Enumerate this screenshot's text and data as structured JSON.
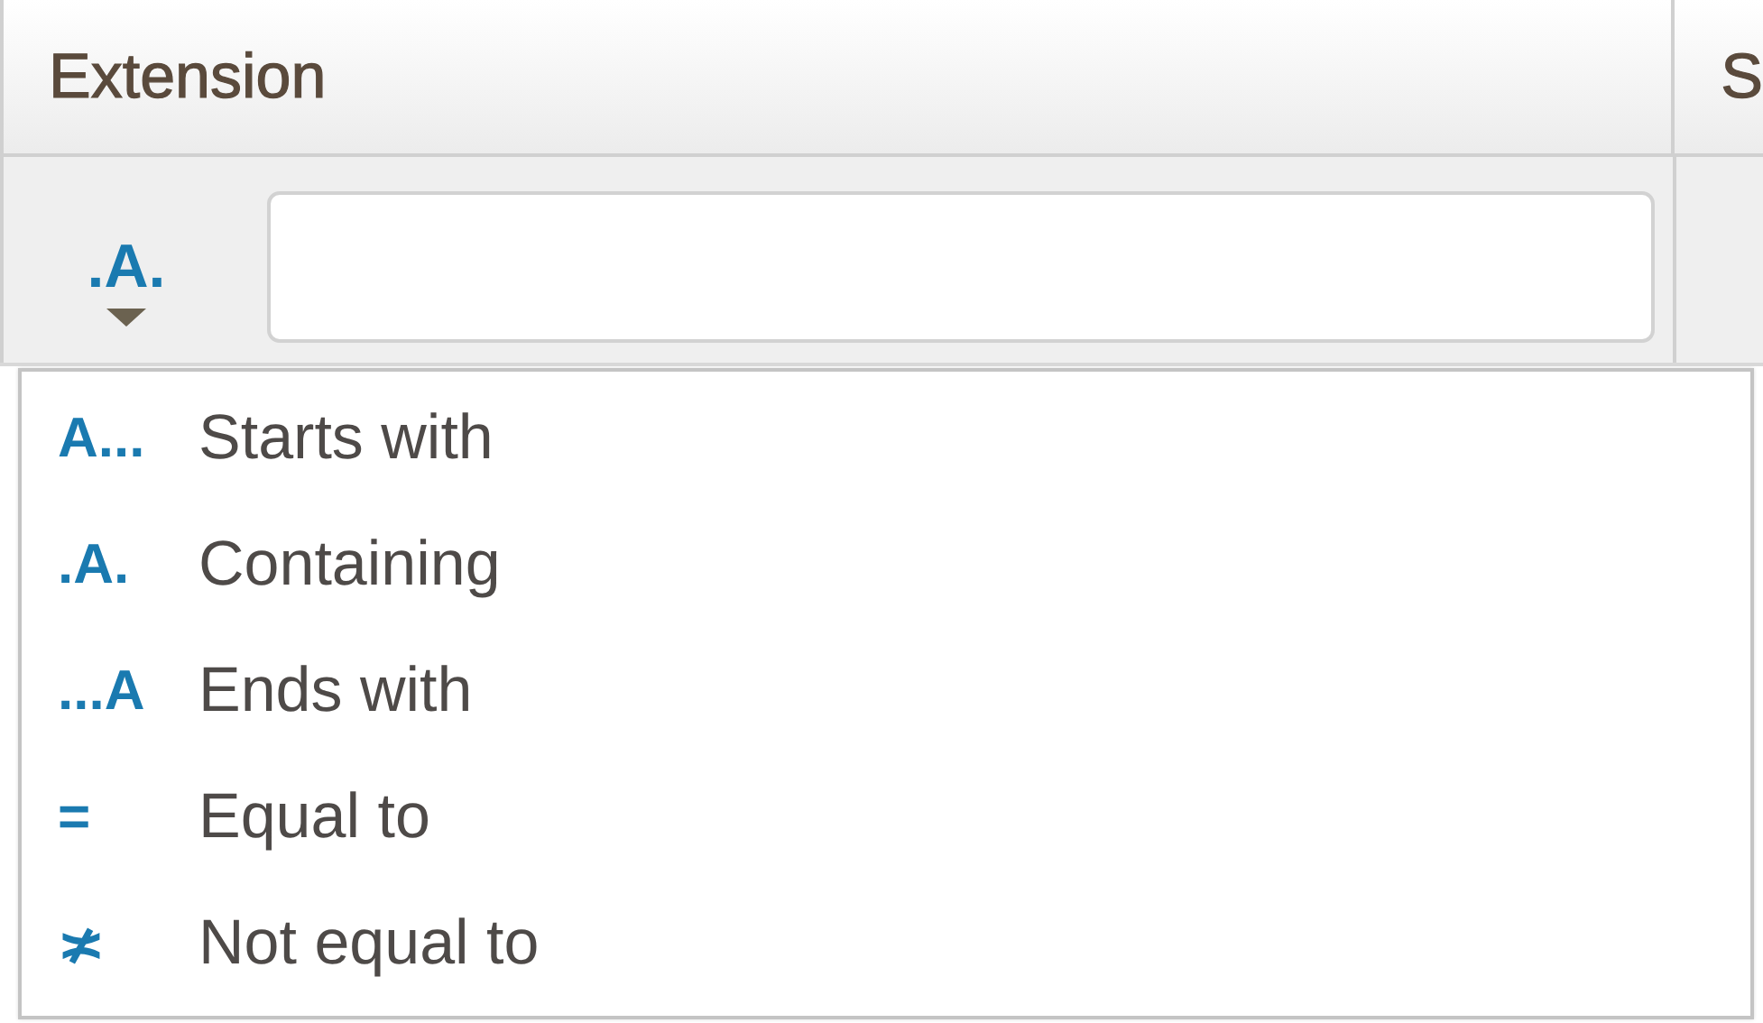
{
  "columns": [
    {
      "header": "Extension"
    },
    {
      "header": "S"
    }
  ],
  "filter": {
    "button_icon": ".A."
  },
  "menu": {
    "items": [
      {
        "icon": "A...",
        "label": "Starts with"
      },
      {
        "icon": ".A.",
        "label": "Containing"
      },
      {
        "icon": "...A",
        "label": "Ends with"
      },
      {
        "icon": "=",
        "label": "Equal to"
      },
      {
        "icon": "≭",
        "label": "Not equal to"
      }
    ]
  }
}
